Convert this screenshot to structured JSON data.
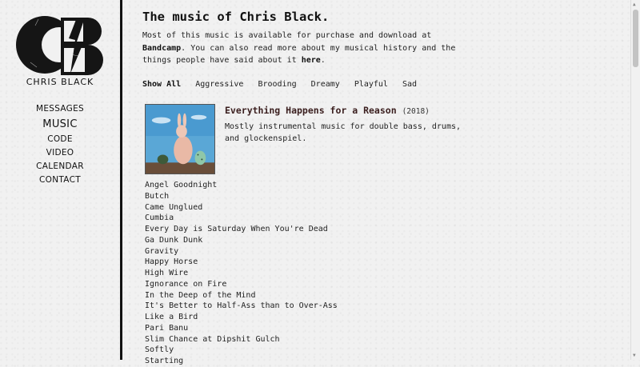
{
  "sidebar": {
    "brand": "CHRIS BLACK",
    "nav": [
      {
        "label": "MESSAGES",
        "active": false
      },
      {
        "label": "MUSIC",
        "active": true
      },
      {
        "label": "CODE",
        "active": false
      },
      {
        "label": "VIDEO",
        "active": false
      },
      {
        "label": "CALENDAR",
        "active": false
      },
      {
        "label": "CONTACT",
        "active": false
      }
    ]
  },
  "main": {
    "title": "The music of Chris Black.",
    "intro": {
      "text1": "Most of this music is available for purchase and download at ",
      "link1": "Bandcamp",
      "text2": ". You can also read more about my musical history and the things people have said about it ",
      "link2": "here",
      "text3": "."
    },
    "filters": [
      "Show All",
      "Aggressive",
      "Brooding",
      "Dreamy",
      "Playful",
      "Sad"
    ],
    "active_filter": "Show All",
    "album": {
      "title": "Everything Happens for a Reason",
      "year": "(2018)",
      "description": "Mostly instrumental music for double bass, drums, and glockenspiel."
    },
    "tracks": [
      "Angel Goodnight",
      "Butch",
      "Came Unglued",
      "Cumbia",
      "Every Day is Saturday When You're Dead",
      "Ga Dunk Dunk",
      "Gravity",
      "Happy Horse",
      "High Wire",
      "Ignorance on Fire",
      "In the Deep of the Mind",
      "It's Better to Half-Ass than to Over-Ass",
      "Like a Bird",
      "Pari Banu",
      "Slim Chance at Dipshit Gulch",
      "Softly",
      "Starting"
    ]
  }
}
